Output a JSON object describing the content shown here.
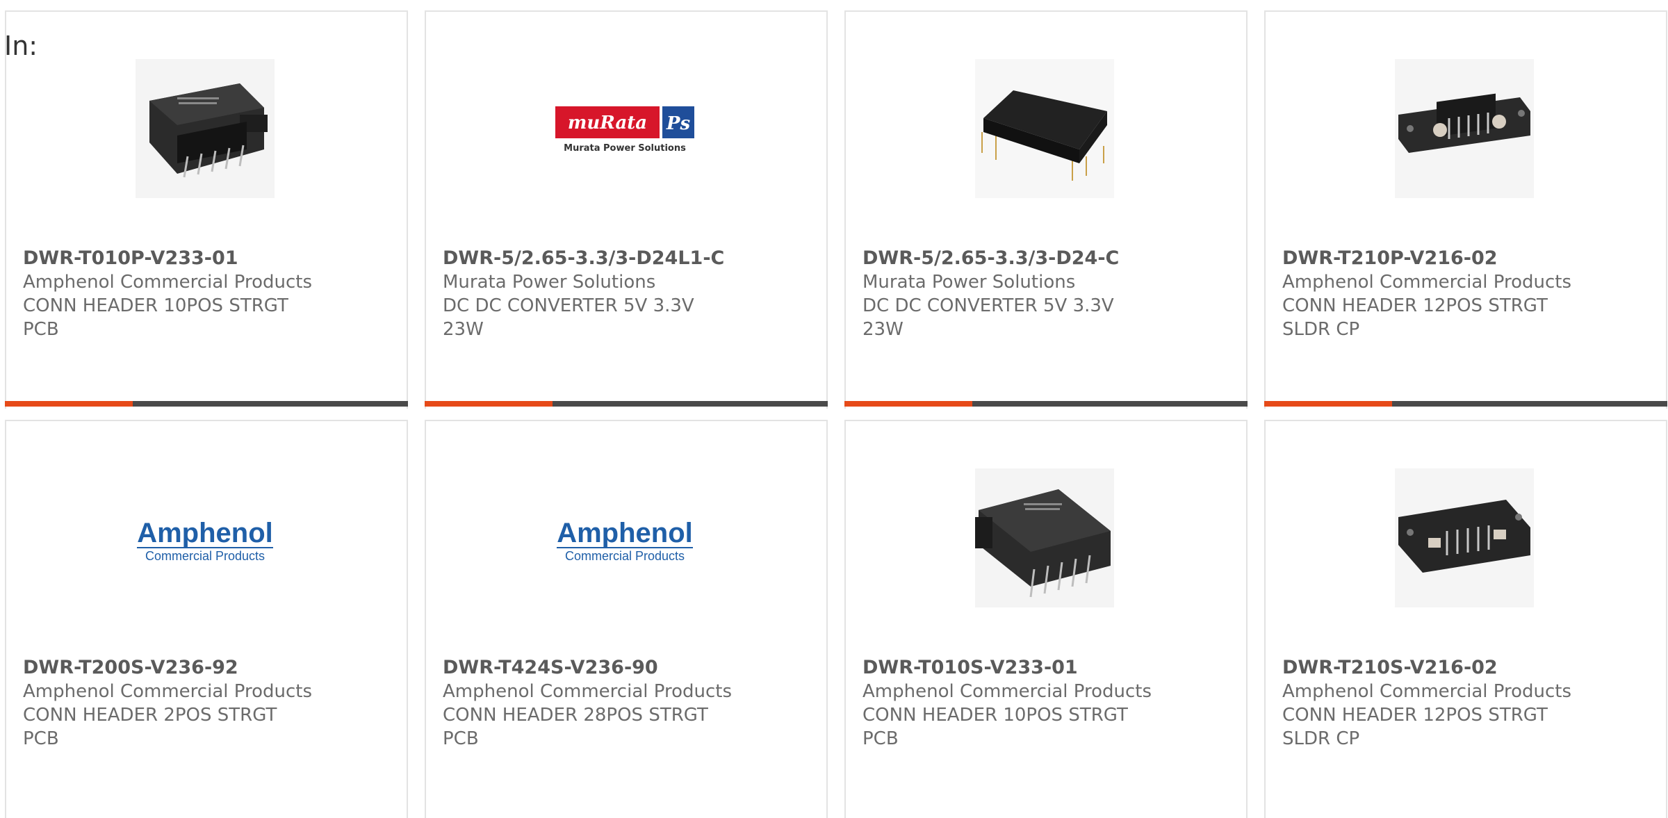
{
  "filter_label": "In:",
  "products": [
    {
      "pn": "DWR-T010P-V233-01",
      "mfr": "Amphenol Commercial Products",
      "desc": "CONN HEADER 10POS STRGT PCB",
      "image": "header-connector-10pos"
    },
    {
      "pn": "DWR-5/2.65-3.3/3-D24L1-C",
      "mfr": "Murata Power Solutions",
      "desc": "DC DC CONVERTER 5V 3.3V 23W",
      "image": "murata-logo",
      "logo_text": {
        "main": "muRata",
        "box": "Ps",
        "sub": "Murata Power Solutions"
      }
    },
    {
      "pn": "DWR-5/2.65-3.3/3-D24-C",
      "mfr": "Murata Power Solutions",
      "desc": "DC DC CONVERTER 5V 3.3V 23W",
      "image": "dc-dc-converter-module"
    },
    {
      "pn": "DWR-T210P-V216-02",
      "mfr": "Amphenol Commercial Products",
      "desc": "CONN HEADER 12POS STRGT SLDR CP",
      "image": "header-connector-12pos"
    },
    {
      "pn": "DWR-T200S-V236-92",
      "mfr": "Amphenol Commercial Products",
      "desc": "CONN HEADER 2POS STRGT PCB",
      "image": "amphenol-logo",
      "logo_text": {
        "main": "Amphenol",
        "sub": "Commercial Products"
      }
    },
    {
      "pn": "DWR-T424S-V236-90",
      "mfr": "Amphenol Commercial Products",
      "desc": "CONN HEADER 28POS STRGT PCB",
      "image": "amphenol-logo",
      "logo_text": {
        "main": "Amphenol",
        "sub": "Commercial Products"
      }
    },
    {
      "pn": "DWR-T010S-V233-01",
      "mfr": "Amphenol Commercial Products",
      "desc": "CONN HEADER 10POS STRGT PCB",
      "image": "header-connector-10pos-angled"
    },
    {
      "pn": "DWR-T210S-V216-02",
      "mfr": "Amphenol Commercial Products",
      "desc": "CONN HEADER 12POS STRGT SLDR CP",
      "image": "header-connector-12pos-angled"
    }
  ],
  "colors": {
    "accent": "#e64a19",
    "bar": "#4a4a4a",
    "border": "#e3e3e3",
    "murata_red": "#d7162a",
    "murata_blue": "#1f4e9a",
    "amphenol_blue": "#1f5fa8"
  }
}
